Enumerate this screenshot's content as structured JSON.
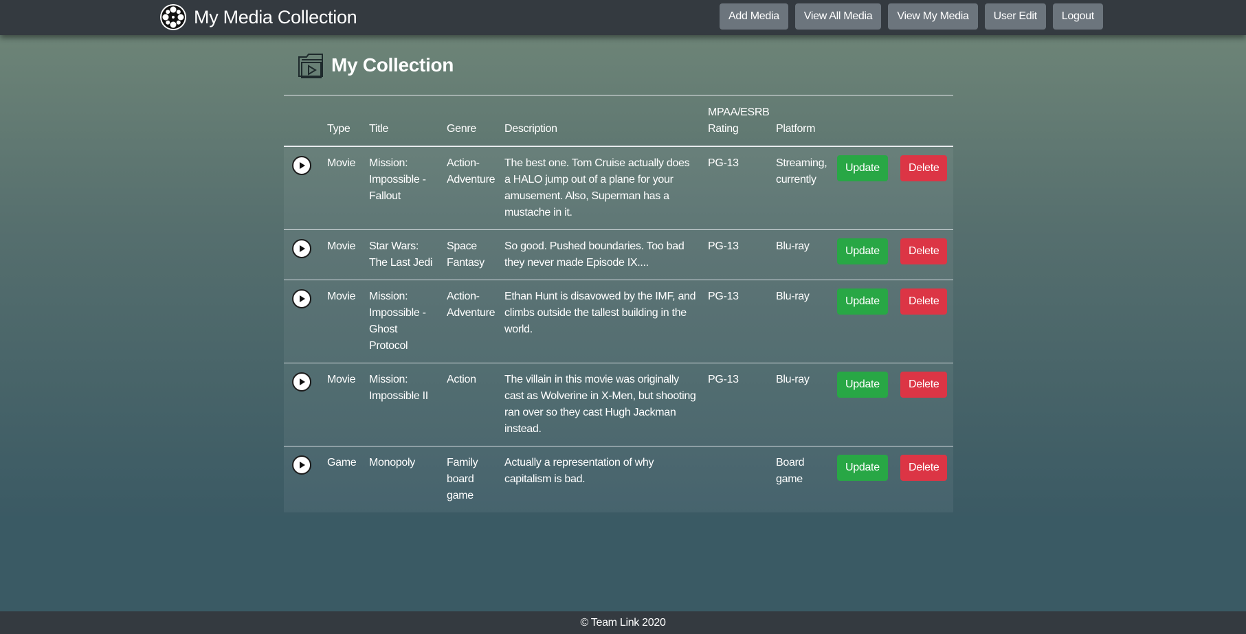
{
  "app": {
    "title": "My Media Collection",
    "logo_icon": "film-reel-icon"
  },
  "nav": {
    "items": [
      {
        "label": "Add Media"
      },
      {
        "label": "View All Media"
      },
      {
        "label": "View My Media"
      },
      {
        "label": "User Edit"
      },
      {
        "label": "Logout"
      }
    ]
  },
  "page": {
    "title": "My Collection",
    "icon": "media-folder-play-icon"
  },
  "table": {
    "headers": [
      "",
      "Type",
      "Title",
      "Genre",
      "Description",
      "MPAA/ESRB Rating",
      "Platform",
      "",
      ""
    ],
    "rows": [
      {
        "type": "Movie",
        "title": "Mission: Impossible - Fallout",
        "genre": "Action-Adventure",
        "description": "The best one. Tom Cruise actually does a HALO jump out of a plane for your amusement. Also, Superman has a mustache in it.",
        "rating": "PG-13",
        "platform": "Streaming, currently",
        "update_label": "Update",
        "delete_label": "Delete"
      },
      {
        "type": "Movie",
        "title": "Star Wars: The Last Jedi",
        "genre": "Space Fantasy",
        "description": "So good. Pushed boundaries. Too bad they never made Episode IX....",
        "rating": "PG-13",
        "platform": "Blu-ray",
        "update_label": "Update",
        "delete_label": "Delete"
      },
      {
        "type": "Movie",
        "title": "Mission: Impossible - Ghost Protocol",
        "genre": "Action-Adventure",
        "description": "Ethan Hunt is disavowed by the IMF, and climbs outside the tallest building in the world.",
        "rating": "PG-13",
        "platform": "Blu-ray",
        "update_label": "Update",
        "delete_label": "Delete"
      },
      {
        "type": "Movie",
        "title": "Mission: Impossible II",
        "genre": "Action",
        "description": "The villain in this movie was originally cast as Wolverine in X-Men, but shooting ran over so they cast Hugh Jackman instead.",
        "rating": "PG-13",
        "platform": "Blu-ray",
        "update_label": "Update",
        "delete_label": "Delete"
      },
      {
        "type": "Game",
        "title": "Monopoly",
        "genre": "Family board game",
        "description": "Actually a representation of why capitalism is bad.",
        "rating": "",
        "platform": "Board game",
        "update_label": "Update",
        "delete_label": "Delete"
      }
    ]
  },
  "footer": {
    "text": "© Team Link 2020"
  },
  "colors": {
    "navbar": "#343a40",
    "nav_button": "#6c757d",
    "update_button": "#28a745",
    "delete_button": "#dc3545"
  }
}
